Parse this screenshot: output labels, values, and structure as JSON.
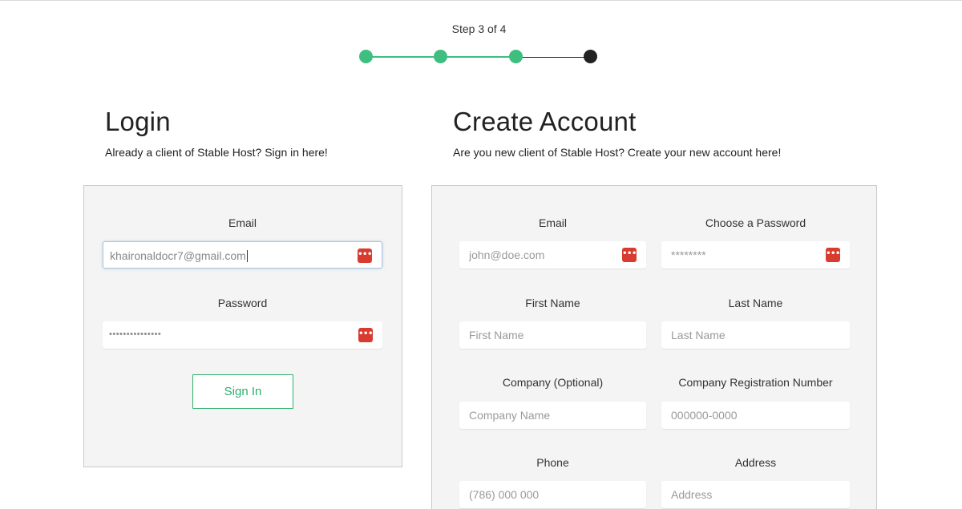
{
  "stepper": {
    "label": "Step 3 of 4",
    "current": 3,
    "total": 4,
    "done_color": "#3fbf7f",
    "todo_color": "#222222"
  },
  "login": {
    "title": "Login",
    "subtitle": "Already a client of Stable Host? Sign in here!",
    "email_label": "Email",
    "email_value": "khaironaldocr7@gmail.com",
    "password_label": "Password",
    "password_value": "•••••••••••••••",
    "sign_in_label": "Sign In"
  },
  "create": {
    "title": "Create Account",
    "subtitle": "Are you new client of Stable Host? Create your new account here!",
    "email": {
      "label": "Email",
      "placeholder": "john@doe.com"
    },
    "password": {
      "label": "Choose a Password",
      "placeholder": "********"
    },
    "first_name": {
      "label": "First Name",
      "placeholder": "First Name"
    },
    "last_name": {
      "label": "Last Name",
      "placeholder": "Last Name"
    },
    "company": {
      "label": "Company (Optional)",
      "placeholder": "Company Name"
    },
    "company_reg": {
      "label": "Company Registration Number",
      "placeholder": "000000-0000"
    },
    "phone": {
      "label": "Phone",
      "placeholder": "(786) 000 000"
    },
    "address": {
      "label": "Address",
      "placeholder": "Address"
    }
  },
  "icons": {
    "password_manager": "password-manager-icon",
    "password_manager_color": "#d83b2f"
  }
}
